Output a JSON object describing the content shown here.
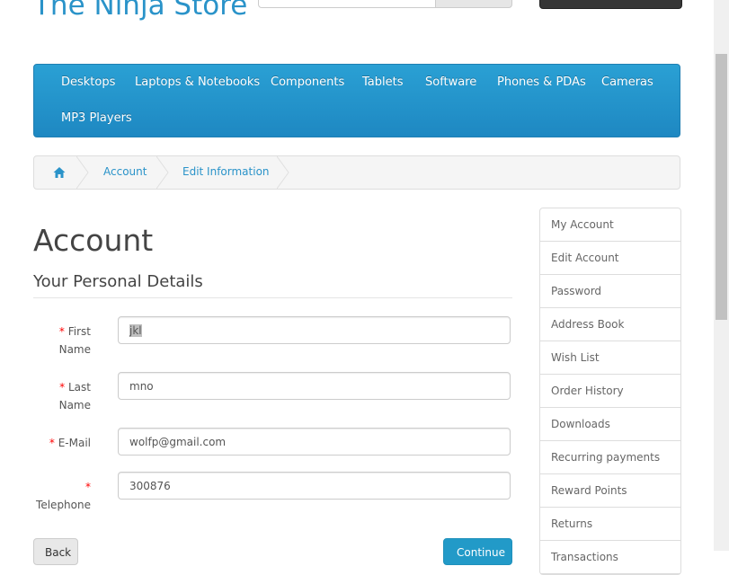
{
  "header": {
    "logo_text": "The Ninja Store"
  },
  "menu": {
    "items": [
      "Desktops",
      "Laptops & Notebooks",
      "Components",
      "Tablets",
      "Software",
      "Phones & PDAs",
      "Cameras",
      "MP3 Players"
    ]
  },
  "breadcrumb": {
    "home_icon": "home-icon",
    "items": [
      "Account",
      "Edit Information"
    ]
  },
  "page": {
    "title": "Account",
    "section_title": "Your Personal Details"
  },
  "form": {
    "required_mark": "*",
    "fields": [
      {
        "label_line1": "First",
        "label_line2": "Name",
        "value": "jkl"
      },
      {
        "label_line1": "Last",
        "label_line2": "Name",
        "value": "mno"
      },
      {
        "label_line1": "E-Mail",
        "label_line2": "",
        "value": "wolfp@gmail.com"
      },
      {
        "label_line1": "",
        "label_line2": "Telephone",
        "value": "300876"
      }
    ],
    "back_label": "Back",
    "continue_label": "Continue"
  },
  "sidebar": {
    "items": [
      "My Account",
      "Edit Account",
      "Password",
      "Address Book",
      "Wish List",
      "Order History",
      "Downloads",
      "Recurring payments",
      "Reward Points",
      "Returns",
      "Transactions"
    ]
  },
  "colors": {
    "accent": "#229ac8",
    "link": "#2a93c9",
    "required": "#ff0000"
  }
}
